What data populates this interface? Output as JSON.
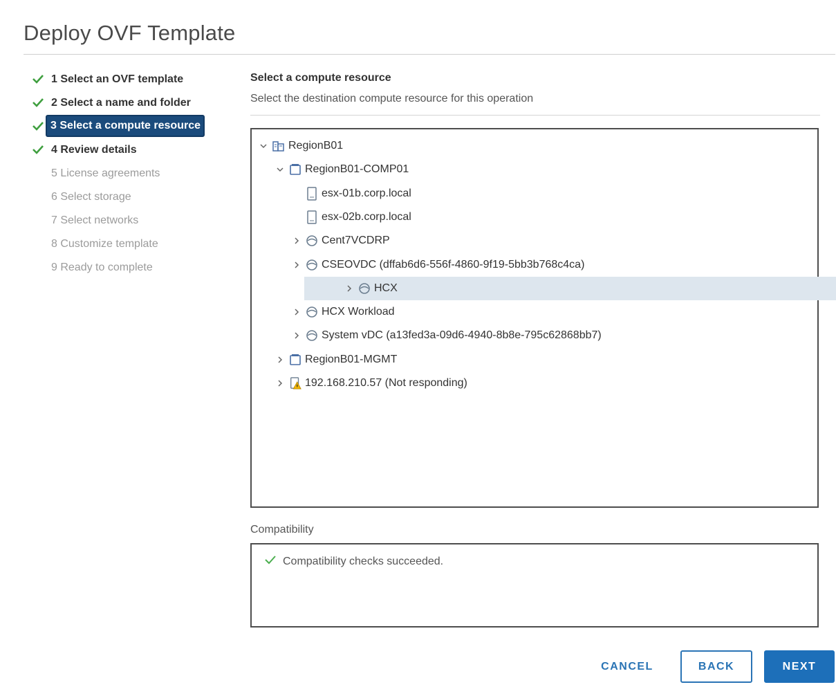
{
  "dialog": {
    "title": "Deploy OVF Template"
  },
  "steps": [
    {
      "label": "1 Select an OVF template",
      "state": "done"
    },
    {
      "label": "2 Select a name and folder",
      "state": "done"
    },
    {
      "label": "3 Select a compute resource",
      "state": "active"
    },
    {
      "label": "4 Review details",
      "state": "done"
    },
    {
      "label": "5 License agreements",
      "state": "todo"
    },
    {
      "label": "6 Select storage",
      "state": "todo"
    },
    {
      "label": "7 Select networks",
      "state": "todo"
    },
    {
      "label": "8 Customize template",
      "state": "todo"
    },
    {
      "label": "9 Ready to complete",
      "state": "todo"
    }
  ],
  "content": {
    "title": "Select a compute resource",
    "subtitle": "Select the destination compute resource for this operation"
  },
  "tree": [
    {
      "label": "RegionB01",
      "icon": "datacenter-icon",
      "expander": "expanded"
    },
    {
      "label": "RegionB01-COMP01",
      "icon": "cluster-icon",
      "expander": "expanded"
    },
    {
      "label": "esx-01b.corp.local",
      "icon": "host-icon",
      "expander": "none"
    },
    {
      "label": "esx-02b.corp.local",
      "icon": "host-icon",
      "expander": "none"
    },
    {
      "label": "Cent7VCDRP",
      "icon": "resource-pool-icon",
      "expander": "collapsed"
    },
    {
      "label": "CSEOVDC (dffab6d6-556f-4860-9f19-5bb3b768c4ca)",
      "icon": "resource-pool-icon",
      "expander": "collapsed"
    },
    {
      "label": "HCX",
      "icon": "resource-pool-icon",
      "expander": "collapsed",
      "selected": true
    },
    {
      "label": "HCX Workload",
      "icon": "resource-pool-icon",
      "expander": "collapsed"
    },
    {
      "label": "System vDC (a13fed3a-09d6-4940-8b8e-795c62868bb7)",
      "icon": "resource-pool-icon",
      "expander": "collapsed"
    },
    {
      "label": "RegionB01-MGMT",
      "icon": "cluster-icon",
      "expander": "collapsed"
    },
    {
      "label": "192.168.210.57 (Not responding)",
      "icon": "host-warning-icon",
      "expander": "collapsed"
    }
  ],
  "compatibility": {
    "label": "Compatibility",
    "message": "Compatibility checks succeeded."
  },
  "buttons": {
    "cancel": "CANCEL",
    "back": "BACK",
    "next": "NEXT"
  },
  "colors": {
    "accent": "#1d6fb9",
    "active_step_bg": "#1b4b7c",
    "check_green": "#3f9f3f",
    "selected_row_bg": "#dde6ee"
  }
}
